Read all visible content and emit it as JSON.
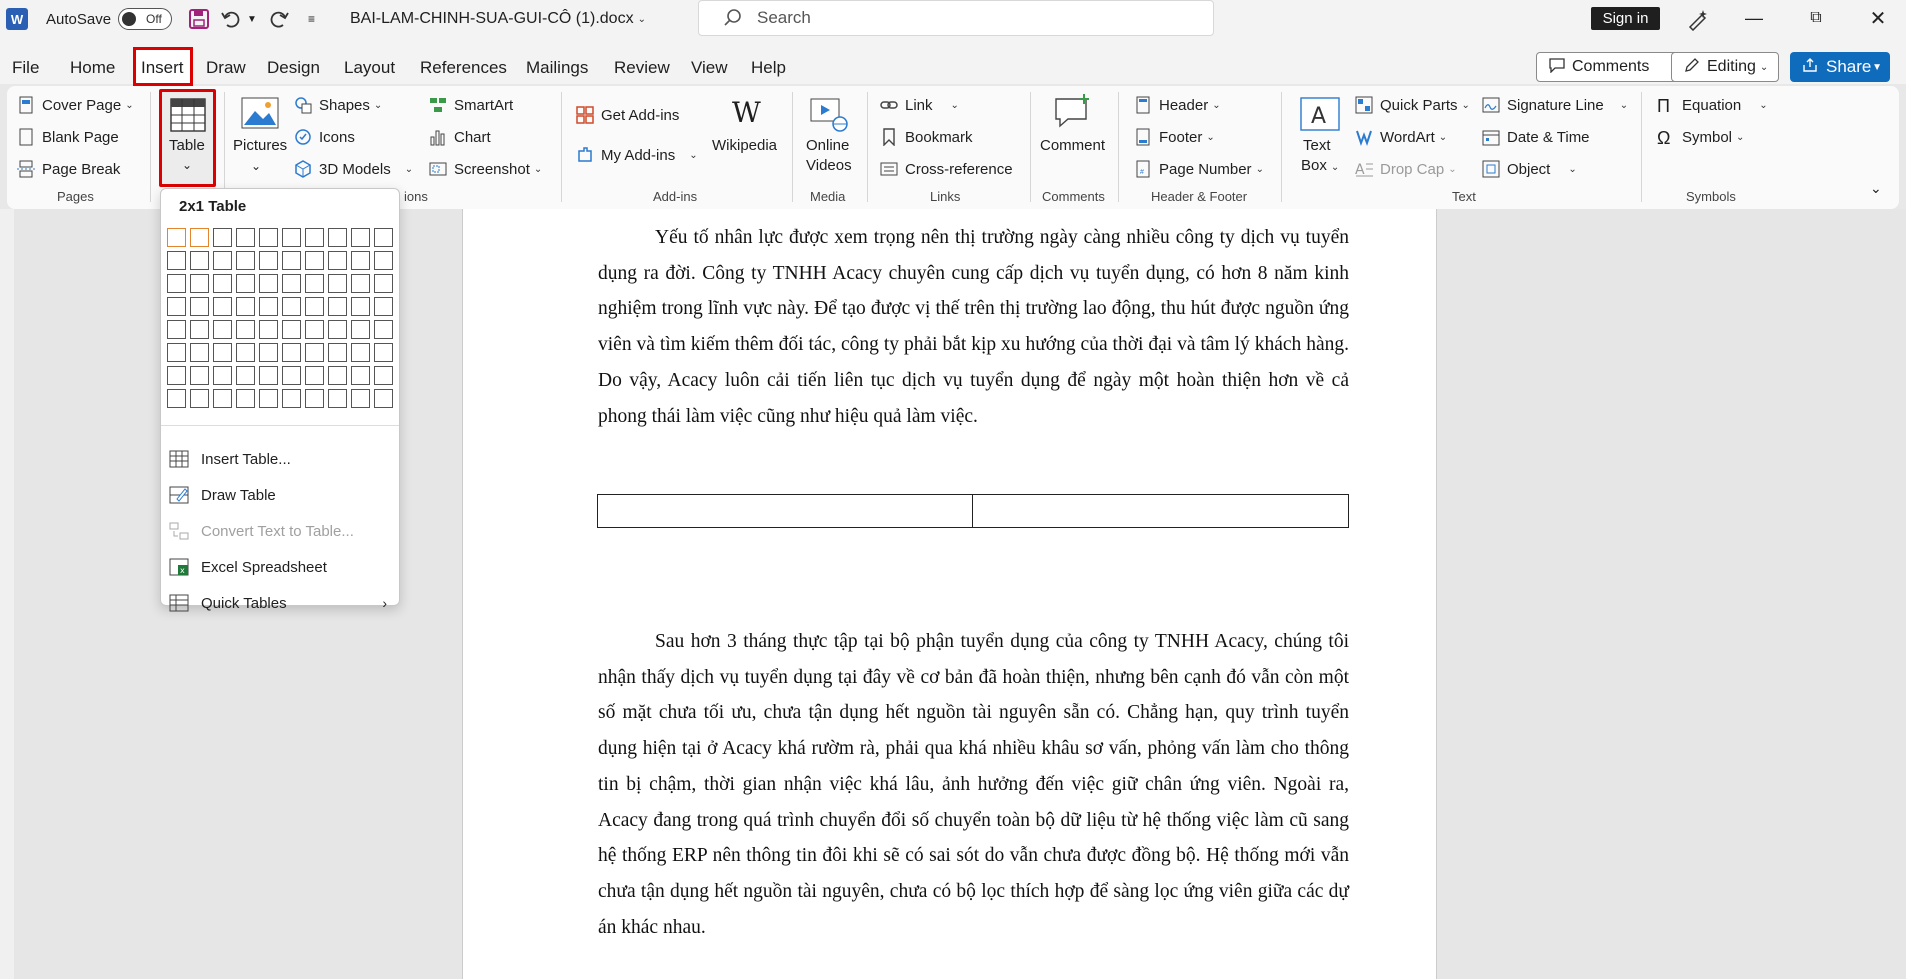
{
  "titlebar": {
    "autosave_label": "AutoSave",
    "autosave_state": "Off",
    "filename": "BAI-LAM-CHINH-SUA-GUI-CÔ (1).docx",
    "search_placeholder": "Search",
    "signin_label": "Sign in"
  },
  "menu": {
    "tabs": [
      "File",
      "Home",
      "Insert",
      "Draw",
      "Design",
      "Layout",
      "References",
      "Mailings",
      "Review",
      "View",
      "Help"
    ],
    "active_tab": "Insert",
    "comments_label": "Comments",
    "editing_label": "Editing",
    "share_label": "Share"
  },
  "ribbon": {
    "pages": {
      "items": [
        "Cover Page",
        "Blank Page",
        "Page Break"
      ],
      "group": "Pages"
    },
    "tables": {
      "label": "Table"
    },
    "illustrations": {
      "pictures": "Pictures",
      "shapes": "Shapes",
      "icons": "Icons",
      "models": "3D Models",
      "smartart": "SmartArt",
      "chart": "Chart",
      "screenshot": "Screenshot",
      "group_fragment": "ions"
    },
    "addins": {
      "get": "Get Add-ins",
      "my": "My Add-ins",
      "wikipedia": "Wikipedia",
      "group": "Add-ins"
    },
    "media": {
      "online_videos_1": "Online",
      "online_videos_2": "Videos",
      "group": "Media"
    },
    "links": {
      "link": "Link",
      "bookmark": "Bookmark",
      "crossref": "Cross-reference",
      "group": "Links"
    },
    "comments": {
      "comment": "Comment",
      "group": "Comments"
    },
    "headerfooter": {
      "header": "Header",
      "footer": "Footer",
      "pagenumber": "Page Number",
      "group": "Header & Footer"
    },
    "text": {
      "textbox_1": "Text",
      "textbox_2": "Box",
      "quickparts": "Quick Parts",
      "wordart": "WordArt",
      "dropcap": "Drop Cap",
      "signature": "Signature Line",
      "datetime": "Date & Time",
      "object": "Object",
      "group": "Text"
    },
    "symbols": {
      "equation": "Equation",
      "symbol": "Symbol",
      "group": "Symbols"
    }
  },
  "dropdown": {
    "title": "2x1 Table",
    "grid_cols": 10,
    "grid_rows": 8,
    "selected_cols": 2,
    "selected_rows": 1,
    "items": [
      {
        "label": "Insert Table...",
        "disabled": false
      },
      {
        "label": "Draw Table",
        "disabled": false
      },
      {
        "label": "Convert Text to Table...",
        "disabled": true
      },
      {
        "label": "Excel Spreadsheet",
        "disabled": false
      },
      {
        "label": "Quick Tables",
        "disabled": false
      }
    ]
  },
  "document": {
    "para1": "Yếu tố nhân lực được xem trọng nên thị trường ngày càng nhiều công ty dịch vụ tuyển dụng ra đời. Công ty TNHH Acacy chuyên cung cấp dịch vụ tuyển dụng, có hơn 8 năm kinh nghiệm trong lĩnh vực này. Để tạo được vị thế trên thị trường lao động, thu hút được nguồn ứng viên và tìm kiếm thêm đối tác, công ty phải bắt kịp xu hướng của thời đại và tâm lý khách hàng. Do vậy, Acacy luôn cải tiến liên tục dịch vụ tuyển dụng để ngày một hoàn thiện hơn về cả phong thái làm việc cũng như hiệu quả làm việc.",
    "para2": "Sau hơn 3 tháng thực tập tại bộ phận tuyển dụng của công ty TNHH Acacy, chúng tôi nhận thấy dịch vụ tuyển dụng tại đây về cơ bản đã hoàn thiện, nhưng bên cạnh đó vẫn còn một số mặt chưa tối ưu, chưa tận dụng hết nguồn tài nguyên sẵn có. Chẳng hạn, quy trình tuyển dụng hiện tại ở Acacy khá rườm rà, phải qua khá nhiều khâu sơ vấn, phỏng vấn làm cho thông tin bị chậm, thời gian nhận việc khá lâu, ảnh hưởng đến việc giữ chân ứng viên. Ngoài ra, Acacy đang trong quá trình chuyển đổi số chuyển toàn bộ dữ liệu từ hệ thống việc làm cũ sang hệ thống ERP nên thông tin đôi khi sẽ có sai sót do vẫn chưa được đồng bộ. Hệ thống mới vẫn chưa tận dụng hết nguồn tài nguyên, chưa có bộ lọc thích hợp để sàng lọc ứng viên giữa các dự án khác nhau."
  },
  "colors": {
    "accent": "#0f6cbd",
    "highlight": "#dd0000",
    "grid_select": "#e3852f"
  }
}
